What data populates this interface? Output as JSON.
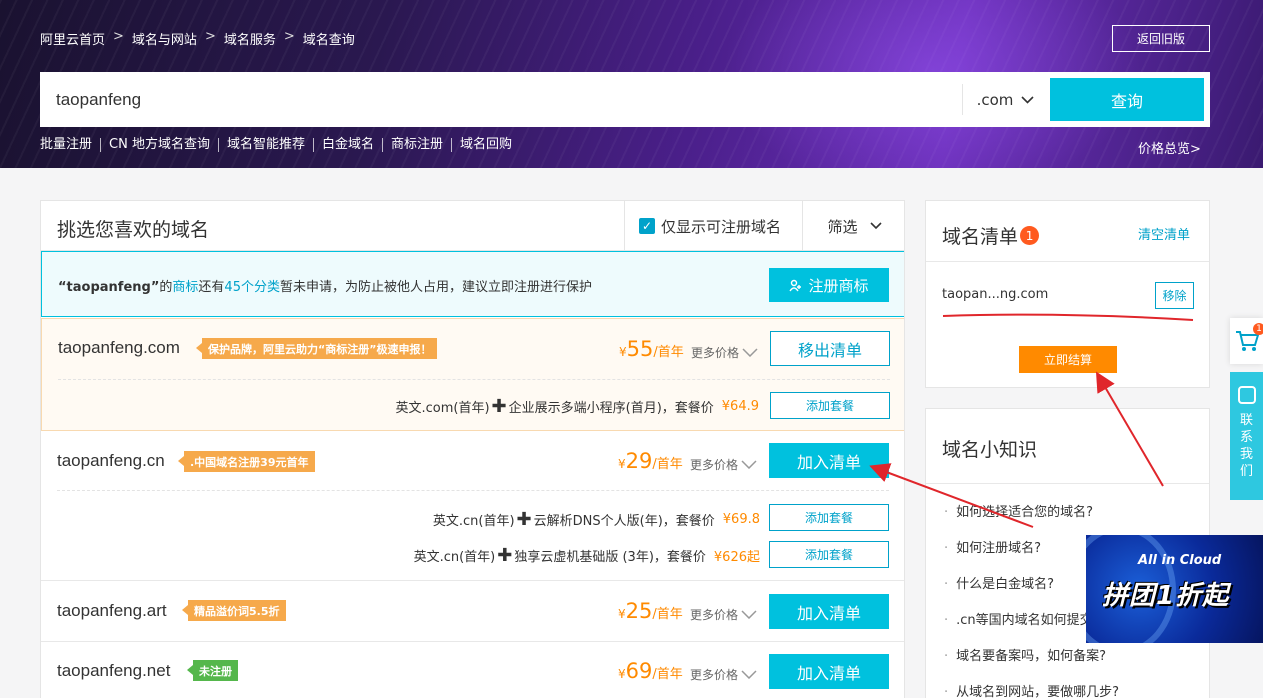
{
  "breadcrumb": [
    "阿里云首页",
    "域名与网站",
    "域名服务",
    "域名查询"
  ],
  "breadcrumb_sep": ">",
  "header": {
    "old_version": "返回旧版"
  },
  "search": {
    "value": "taopanfeng",
    "tld": ".com",
    "submit": "查询"
  },
  "quick_links": [
    "批量注册",
    "CN 地方域名查询",
    "域名智能推荐",
    "白金域名",
    "商标注册",
    "域名回购"
  ],
  "price_overview": "价格总览>",
  "main": {
    "title": "挑选您喜欢的域名",
    "only_available": "仅显示可注册域名",
    "filter": "筛选"
  },
  "notice": {
    "name": "“taopanfeng”",
    "p1": "的",
    "trademark": "商标",
    "p2": "还有",
    "categories": "45个分类",
    "p3": "暂未申请，为防止被他人占用，建议立即注册进行保护",
    "button": "注册商标"
  },
  "domains": [
    {
      "name": "taopanfeng.com",
      "tag": "保护品牌，阿里云助力“商标注册”极速申报！",
      "price": "55",
      "unit": "/首年",
      "more": "更多价格",
      "action": "移出清单"
    },
    {
      "name": "taopanfeng.cn",
      "tag": ".中国域名注册39元首年",
      "price": "29",
      "unit": "/首年",
      "more": "更多价格",
      "action": "加入清单"
    },
    {
      "name": "taopanfeng.art",
      "tag": "精品溢价词5.5折",
      "price": "25",
      "unit": "/首年",
      "more": "更多价格",
      "action": "加入清单"
    },
    {
      "name": "taopanfeng.net",
      "tag": "未注册",
      "price": "69",
      "unit": "/首年",
      "more": "更多价格",
      "action": "加入清单"
    }
  ],
  "currency": "¥",
  "packages": [
    {
      "left": "英文.com(首年)",
      "right": "企业展示多端小程序(首月)，套餐价",
      "price": "¥64.9",
      "button": "添加套餐"
    },
    {
      "left": "英文.cn(首年)",
      "right": "云解析DNS个人版(年)，套餐价",
      "price": "¥69.8",
      "button": "添加套餐"
    },
    {
      "left": "英文.cn(首年)",
      "right": "独享云虚机基础版 (3年)，套餐价",
      "price": "¥626起",
      "button": "添加套餐"
    }
  ],
  "cart": {
    "title": "域名清单",
    "count": "1",
    "clear": "清空清单",
    "item": "taopan...ng.com",
    "remove": "移除",
    "checkout": "立即结算"
  },
  "tips": {
    "title": "域名小知识",
    "items": [
      "如何选择适合您的域名?",
      "如何注册域名?",
      "什么是白金域名?",
      ".cn等国内域名如何提交",
      "域名要备案吗，如何备案?",
      "从域名到网站，要做哪几步?"
    ]
  },
  "side": {
    "cart_count": "1",
    "contact": [
      "联",
      "系",
      "我",
      "们"
    ]
  },
  "ad": {
    "sub": "All in Cloud",
    "main": "拼团1折起"
  },
  "colors": {
    "accent": "#00c1de",
    "price": "#ff8a00",
    "tag": "#f6a94b",
    "tag_green": "#55b74c",
    "annotation": "#e0262b"
  }
}
